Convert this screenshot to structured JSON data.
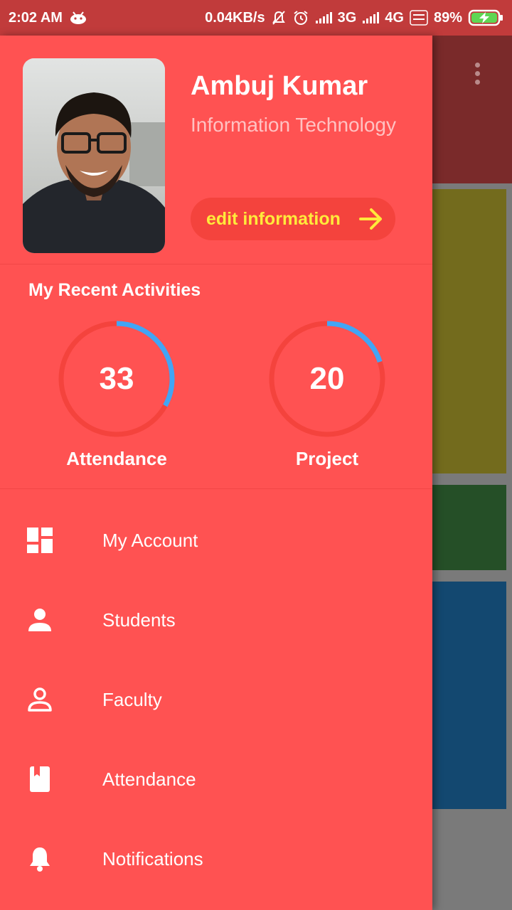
{
  "status_bar": {
    "time": "2:02 AM",
    "net_speed": "0.04KB/s",
    "net_3g": "3G",
    "net_4g": "4G",
    "battery": "89%"
  },
  "profile": {
    "name": "Ambuj Kumar",
    "department": "Information Technology",
    "edit_label": "edit information"
  },
  "activities": {
    "title": "My Recent Activities",
    "items": [
      {
        "value": "33",
        "label": "Attendance",
        "progress": 0.33
      },
      {
        "value": "20",
        "label": "Project",
        "progress": 0.2
      }
    ]
  },
  "menu": [
    {
      "label": "My Account",
      "icon": "dashboard-icon"
    },
    {
      "label": "Students",
      "icon": "person-icon"
    },
    {
      "label": "Faculty",
      "icon": "person-outline-icon"
    },
    {
      "label": "Attendance",
      "icon": "book-icon"
    },
    {
      "label": "Notifications",
      "icon": "bell-icon"
    }
  ],
  "colors": {
    "drawer_bg": "#ff5252",
    "gauge_track": "#f4433d",
    "gauge_progress": "#42a5f5",
    "edit_text": "#ffea3b"
  }
}
